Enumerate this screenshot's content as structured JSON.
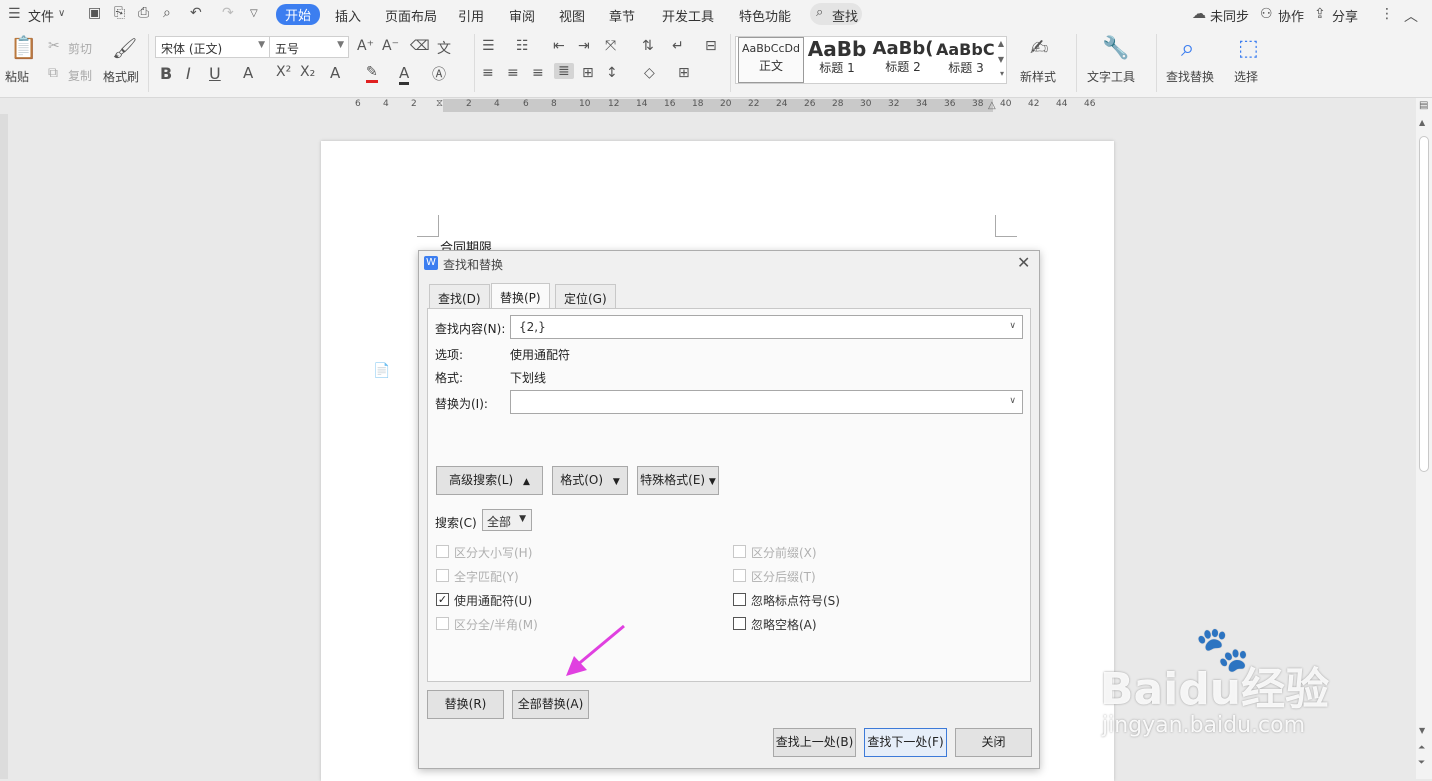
{
  "menubar": {
    "file": "文件",
    "tabs": [
      "开始",
      "插入",
      "页面布局",
      "引用",
      "审阅",
      "视图",
      "章节",
      "开发工具",
      "特色功能"
    ],
    "search": "查找",
    "unsynced": "未同步",
    "collaborate": "协作",
    "share": "分享"
  },
  "ribbon": {
    "paste": "粘贴",
    "cut": "剪切",
    "copy": "复制",
    "format_painter": "格式刷",
    "font_name": "宋体 (正文)",
    "font_size": "五号",
    "styles": [
      {
        "sample": "AaBbCcDd",
        "name": "正文"
      },
      {
        "sample": "AaBb",
        "name": "标题 1"
      },
      {
        "sample": "AaBb(",
        "name": "标题 2"
      },
      {
        "sample": "AaBbC(",
        "name": "标题 3"
      }
    ],
    "new_style": "新样式",
    "text_tools": "文字工具",
    "find_replace": "查找替换",
    "select": "选择"
  },
  "ruler": {
    "numbers": [
      "6",
      "4",
      "2",
      "2",
      "4",
      "6",
      "8",
      "10",
      "12",
      "14",
      "16",
      "18",
      "20",
      "22",
      "24",
      "26",
      "28",
      "30",
      "32",
      "34",
      "36",
      "38",
      "40",
      "42",
      "44",
      "46"
    ]
  },
  "document": {
    "text": "合同期限"
  },
  "dialog": {
    "title": "查找和替换",
    "tabs": [
      "查找(D)",
      "替换(P)",
      "定位(G)"
    ],
    "find_label": "查找内容(N):",
    "find_value": "{2,}",
    "options_label": "选项:",
    "options_value": "使用通配符",
    "format_label": "格式:",
    "format_value": "下划线",
    "replace_label": "替换为(I):",
    "replace_value": "",
    "advanced_button": "高级搜索(L)",
    "format_button": "格式(O)",
    "special_button": "特殊格式(E)",
    "search_label": "搜索(C)",
    "search_scope": "全部",
    "checkboxes": [
      {
        "label": "区分大小写(H)",
        "checked": false,
        "disabled": true
      },
      {
        "label": "全字匹配(Y)",
        "checked": false,
        "disabled": true
      },
      {
        "label": "使用通配符(U)",
        "checked": true,
        "disabled": false
      },
      {
        "label": "区分全/半角(M)",
        "checked": false,
        "disabled": true
      },
      {
        "label": "区分前缀(X)",
        "checked": false,
        "disabled": true
      },
      {
        "label": "区分后缀(T)",
        "checked": false,
        "disabled": true
      },
      {
        "label": "忽略标点符号(S)",
        "checked": false,
        "disabled": false
      },
      {
        "label": "忽略空格(A)",
        "checked": false,
        "disabled": false
      }
    ],
    "replace_button": "替换(R)",
    "replace_all_button": "全部替换(A)",
    "find_prev_button": "查找上一处(B)",
    "find_next_button": "查找下一处(F)",
    "close_button": "关闭"
  },
  "watermark": {
    "line1": "Baidu经验",
    "line2": "jingyan.baidu.com"
  },
  "colors": {
    "accent": "#3c7ef0",
    "arrow": "#e040e0"
  }
}
